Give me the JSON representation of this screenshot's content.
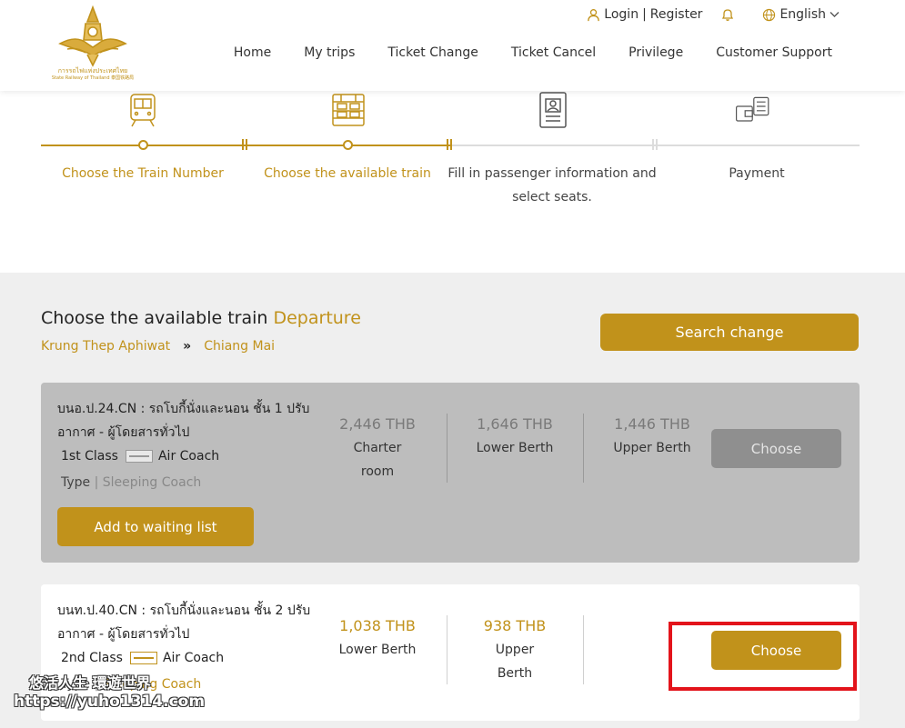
{
  "header": {
    "logo_text_th": "การรถไฟแห่งประเทศไทย",
    "logo_text_en": "State Railway of Thailand 泰国铁路局",
    "login_label": "Login",
    "register_label": "Register",
    "language": "English",
    "nav": [
      "Home",
      "My trips",
      "Ticket Change",
      "Ticket Cancel",
      "Privilege",
      "Customer Support"
    ]
  },
  "steps": [
    {
      "label": "Choose the Train Number",
      "icon": "train-front-icon",
      "state": "done"
    },
    {
      "label": "Choose the available train",
      "icon": "train-coach-icon",
      "state": "active"
    },
    {
      "label": "Fill in passenger information and select seats.",
      "icon": "passenger-id-icon",
      "state": "pending"
    },
    {
      "label": "Payment",
      "icon": "wallet-payment-icon",
      "state": "pending"
    }
  ],
  "section": {
    "title": "Choose the available train",
    "title_accent": "Departure",
    "route_from": "Krung Thep Aphiwat",
    "route_arrow": "»",
    "route_to": "Chiang Mai",
    "search_change_label": "Search change"
  },
  "trains": [
    {
      "name": "บนอ.ป.24.CN : รถโบกี้นั่งและนอน ชั้น 1 ปรับอากาศ - ผู้โดยสารทั่วไป",
      "class_label": "1st Class",
      "coach_label": "Air Coach",
      "type_label": "Type",
      "type_sep": "|",
      "type_value": "Sleeping Coach",
      "waiting_label": "Add to waiting list",
      "prices": [
        {
          "price": "2,446 THB",
          "name": "Charter room"
        },
        {
          "price": "1,646 THB",
          "name": "Lower Berth"
        },
        {
          "price": "1,446 THB",
          "name": "Upper Berth"
        }
      ],
      "choose_label": "Choose",
      "available": false
    },
    {
      "name": "บนท.ป.40.CN : รถโบกี้นั่งและนอน ชั้น 2 ปรับอากาศ - ผู้โดยสารทั่วไป",
      "class_label": "2nd Class",
      "coach_label": "Air Coach",
      "type_label": "Type",
      "type_sep": "|",
      "type_value": "Sleeping Coach",
      "prices": [
        {
          "price": "1,038 THB",
          "name": "Lower Berth"
        },
        {
          "price": "938 THB",
          "name": "Upper Berth"
        }
      ],
      "choose_label": "Choose",
      "available": true
    }
  ],
  "watermark": {
    "line1": "悠活人生  環遊世界",
    "line2": "https://yuho1314.com"
  },
  "colors": {
    "accent": "#c1921b",
    "disabled_card": "#bdbdbd",
    "highlight": "#e3141b"
  }
}
